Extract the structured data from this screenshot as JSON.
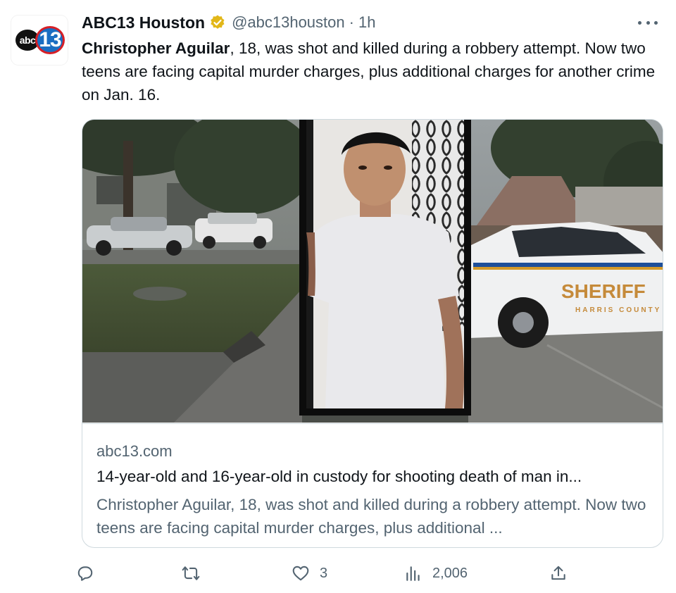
{
  "account": {
    "name": "ABC13 Houston",
    "handle": "@abc13houston",
    "separator": "·",
    "time": "1h",
    "avatar_logo": {
      "abc": "abc",
      "num": "13"
    },
    "verified_color": "#e2b719"
  },
  "tweet": {
    "bold_name": "Christopher Aguilar",
    "text_rest": ", 18, was shot and killed during a robbery attempt. Now two teens are facing capital murder charges, plus additional charges for another crime on Jan. 16."
  },
  "card": {
    "domain": "abc13.com",
    "headline": "14-year-old and 16-year-old in custody for shooting death of man in...",
    "description": "Christopher Aguilar, 18, was shot and killed during a robbery attempt. Now two teens are facing capital murder charges, plus additional ...",
    "image_icons": [
      "street-photo",
      "portrait-photo",
      "sheriff-car-photo"
    ],
    "car_text": {
      "sheriff": "SHERIFF",
      "county": "HARRIS COUNTY"
    }
  },
  "actions": {
    "reply": {
      "icon": "reply-icon",
      "count": ""
    },
    "retweet": {
      "icon": "retweet-icon",
      "count": ""
    },
    "like": {
      "icon": "like-icon",
      "count": "3"
    },
    "views": {
      "icon": "views-icon",
      "count": "2,006"
    },
    "share": {
      "icon": "share-icon"
    }
  },
  "colors": {
    "text_primary": "#0f1419",
    "text_secondary": "#536471",
    "border": "#cfd9de",
    "abc13_blue": "#1b6ec2",
    "abc13_red": "#d71f26"
  }
}
